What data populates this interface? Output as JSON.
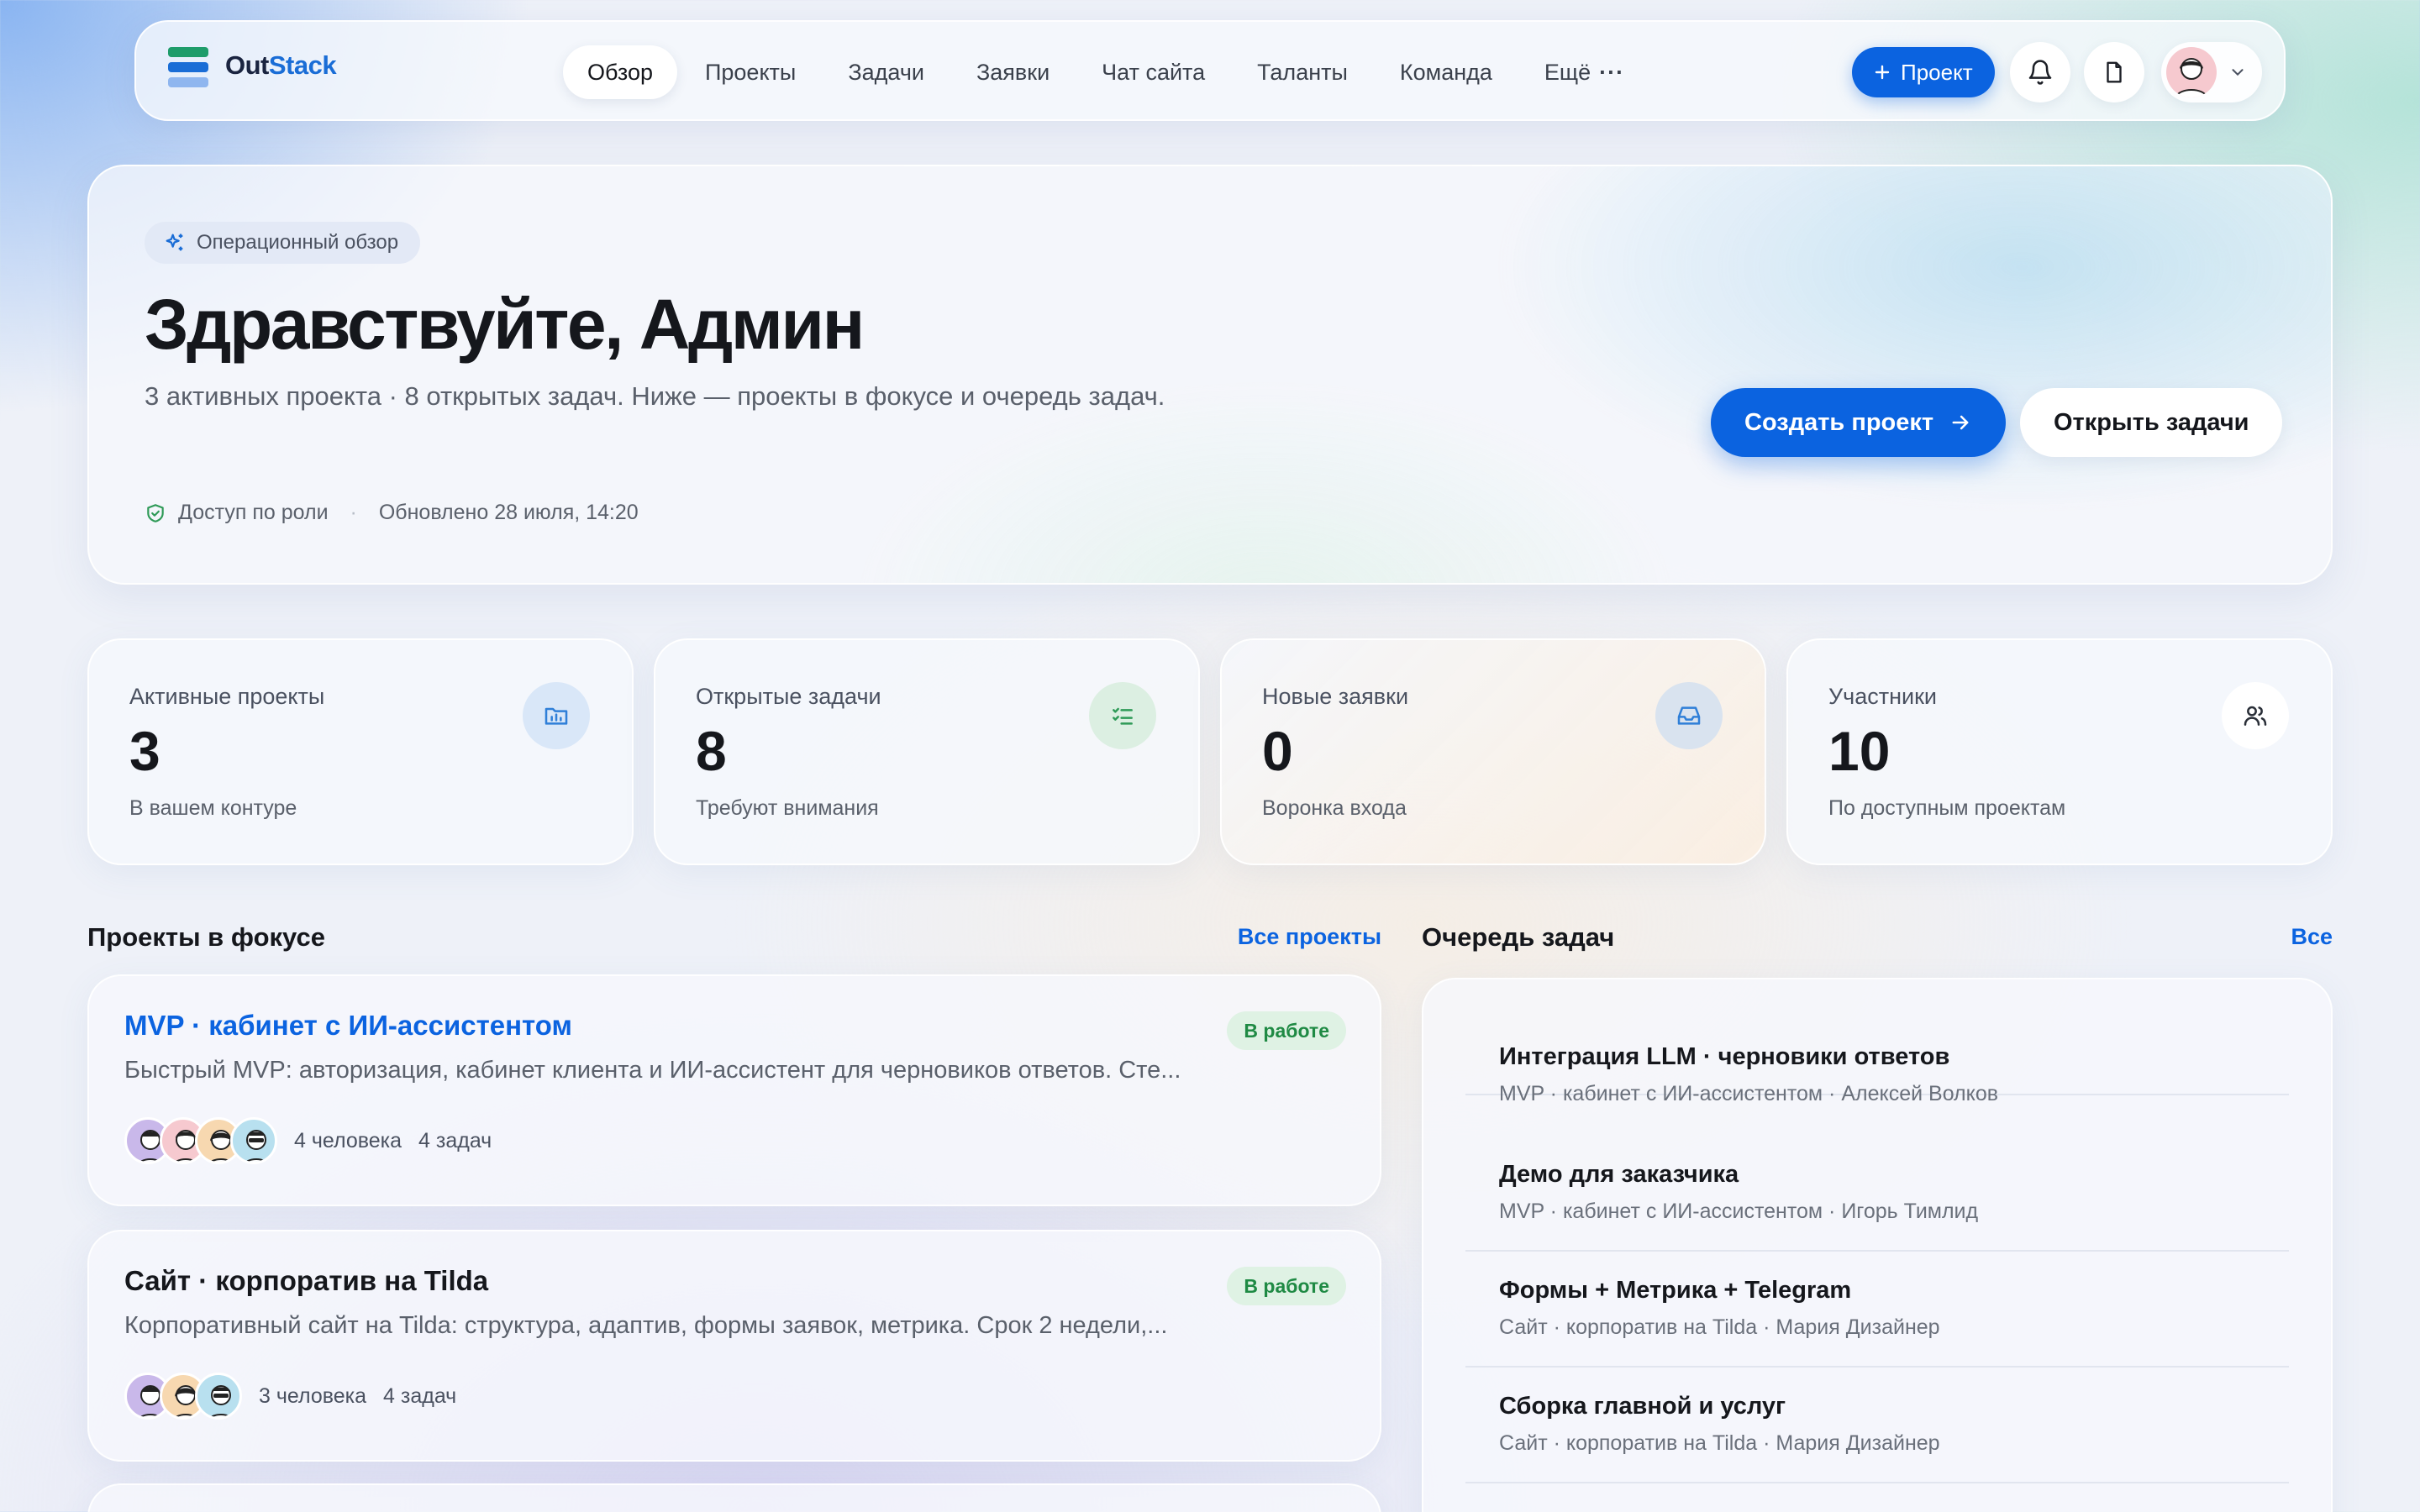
{
  "brand": {
    "name_part1": "Out",
    "name_part2": "Stack"
  },
  "nav": {
    "items": [
      "Обзор",
      "Проекты",
      "Задачи",
      "Заявки",
      "Чат сайта",
      "Таланты",
      "Команда",
      "Ещё"
    ],
    "active": "Обзор"
  },
  "header": {
    "new_project_label": "Проект"
  },
  "hero": {
    "chip": "Операционный обзор",
    "title": "Здравствуйте, Админ",
    "subtitle": "3 активных проекта · 8 открытых задач. Ниже — проекты в фокусе и очередь задач.",
    "access": "Доступ по роли",
    "separator": "·",
    "updated": "Обновлено 28 июля, 14:20",
    "create_label": "Создать проект",
    "open_label": "Открыть задачи"
  },
  "stats": [
    {
      "label": "Активные проекты",
      "value": "3",
      "hint": "В вашем контуре",
      "icon": "folder-chart-icon",
      "color": "#2f7fd8"
    },
    {
      "label": "Открытые задачи",
      "value": "8",
      "hint": "Требуют внимания",
      "icon": "checklist-icon",
      "color": "#2e9a57"
    },
    {
      "label": "Новые заявки",
      "value": "0",
      "hint": "Воронка входа",
      "icon": "inbox-icon",
      "color": "#2f7fd8"
    },
    {
      "label": "Участники",
      "value": "10",
      "hint": "По доступным проектам",
      "icon": "users-icon",
      "color": "#2a2f38"
    }
  ],
  "projects_section": {
    "title": "Проекты в фокусе",
    "link": "Все проекты"
  },
  "projects": [
    {
      "title": "MVP · кабинет с ИИ-ассистентом",
      "description": "Быстрый MVP: авторизация, кабинет клиента и ИИ-ассистент для черновиков ответов. Сте...",
      "status": "В работе",
      "people": "4 человека",
      "tasks": "4 задач"
    },
    {
      "title": "Сайт · корпоратив на Tilda",
      "description": "Корпоративный сайт на Tilda: структура, адаптив, формы заявок, метрика. Срок 2 недели,...",
      "status": "В работе",
      "people": "3 человека",
      "tasks": "4 задач"
    }
  ],
  "queue_section": {
    "title": "Очередь задач",
    "link": "Все"
  },
  "queue": [
    {
      "title": "Интеграция LLM · черновики ответов",
      "meta": "MVP · кабинет с ИИ-ассистентом · Алексей Волков"
    },
    {
      "title": "Демо для заказчика",
      "meta": "MVP · кабинет с ИИ-ассистентом · Игорь Тимлид"
    },
    {
      "title": "Формы + Метрика + Telegram",
      "meta": "Сайт · корпоратив на Tilda · Мария Дизайнер"
    },
    {
      "title": "Сборка главной и услуг",
      "meta": "Сайт · корпоратив на Tilda · Мария Дизайнер"
    }
  ]
}
